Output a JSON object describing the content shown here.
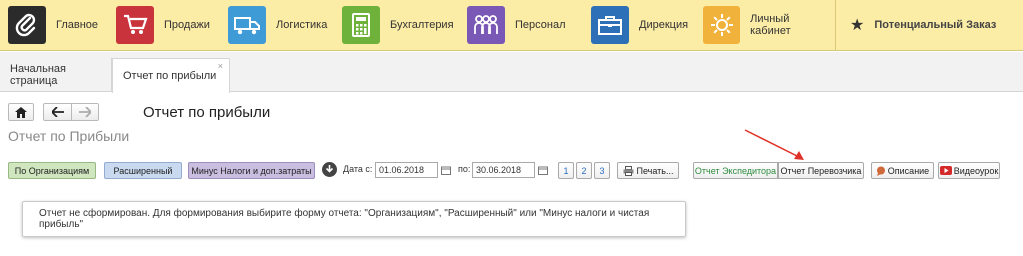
{
  "sections": [
    {
      "label": "Главное",
      "icon": "paperclip-icon",
      "color": "#2b2b2b"
    },
    {
      "label": "Продажи",
      "icon": "cart-icon",
      "color": "#c9343c"
    },
    {
      "label": "Логистика",
      "icon": "truck-icon",
      "color": "#3e9bd6"
    },
    {
      "label": "Бухгалтерия",
      "icon": "calculator-icon",
      "color": "#6fb23b"
    },
    {
      "label": "Персонал",
      "icon": "people-icon",
      "color": "#7a58b5"
    },
    {
      "label": "Дирекция",
      "icon": "briefcase-icon",
      "color": "#2d70b8"
    },
    {
      "label": "Личный кабинет",
      "icon": "gear-icon",
      "color": "#f0b23a"
    }
  ],
  "potential_order": {
    "label": "Потенциальный Заказ",
    "icon": "star-icon"
  },
  "tabs": [
    {
      "label": "Начальная страница"
    },
    {
      "label": "Отчет по прибыли",
      "close": "×"
    }
  ],
  "page": {
    "heading": "Отчет по прибыли",
    "subtitle": "Отчет по Прибыли"
  },
  "toolbar": {
    "by_org": "По Организациям",
    "extended": "Расширенный",
    "minus_taxes": "Минус Налоги и доп.затраты",
    "date_from_label": "Дата с:",
    "date_from": "01.06.2018",
    "date_to_label": "по:",
    "date_to": "30.06.2018",
    "period_1": "1",
    "period_2": "2",
    "period_3": "3",
    "print": "Печать...",
    "forwarder_report": "Отчет Экспедитора",
    "carrier_report": "Отчет Перевозчика",
    "description": "Описание",
    "video": "Видеоурок"
  },
  "message": "Отчет не сформирован. Для формирования выбирите форму отчета: \"Организациям\", \"Расширенный\" или \"Минус налоги и чистая прибыль\"",
  "colors": {
    "topbar": "#fbeca6",
    "annotation_arrow": "#e0322b"
  }
}
